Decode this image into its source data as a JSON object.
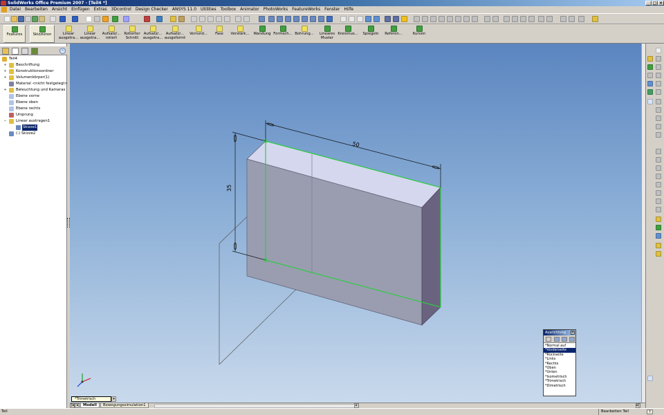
{
  "window": {
    "title": "SolidWorks Office Premium 2007 - [Teil4 *]",
    "controls": {
      "minimize": "_",
      "maximize": "□",
      "close": "×"
    }
  },
  "menu": {
    "items": [
      "Datei",
      "Bearbeiten",
      "Ansicht",
      "Einfügen",
      "Extras",
      "3Dcontrol",
      "Design Checker",
      "ANSYS 11.0",
      "Utilities",
      "Toolbox",
      "Animator",
      "PhotoWorks",
      "FeatureWorks",
      "Fenster",
      "Hilfe"
    ]
  },
  "command_manager": {
    "tabs": [
      {
        "label": "Features"
      },
      {
        "label": "Skizzieren"
      }
    ],
    "buttons": [
      {
        "line1": "Linear",
        "line2": "ausgetra..."
      },
      {
        "line1": "Linear",
        "line2": "ausgetra..."
      },
      {
        "line1": "Aufsatz/...",
        "line2": "rotiert"
      },
      {
        "line1": "Rotierter",
        "line2": "Schnitt"
      },
      {
        "line1": "Aufsatz/...",
        "line2": "ausgetra..."
      },
      {
        "line1": "Aufsatz/...",
        "line2": "ausgeformt"
      },
      {
        "line1": "Verrund...",
        "line2": ""
      },
      {
        "line1": "Fase",
        "line2": ""
      },
      {
        "line1": "Verstärk...",
        "line2": ""
      },
      {
        "line1": "Wandung",
        "line2": ""
      },
      {
        "line1": "Formsch...",
        "line2": ""
      },
      {
        "line1": "Bohrung...",
        "line2": ""
      },
      {
        "line1": "Lineares",
        "line2": "Muster"
      },
      {
        "line1": "Kreismus...",
        "line2": ""
      },
      {
        "line1": "Spiegeln",
        "line2": ""
      },
      {
        "line1": "Referen...",
        "line2": ""
      },
      {
        "line1": "Kurven",
        "line2": ""
      }
    ]
  },
  "feature_tree": {
    "items": [
      {
        "label": "Teil4",
        "icon": "part-icon"
      },
      {
        "label": "Beschriftung",
        "icon": "annotation-icon"
      },
      {
        "label": "Konstruktionsordner",
        "icon": "sensor-icon"
      },
      {
        "label": "Volumenkörper(1)",
        "icon": "solid-bodies-icon"
      },
      {
        "label": "Material <nicht festgelegt>",
        "icon": "material-icon"
      },
      {
        "label": "Beleuchtung und Kameras",
        "icon": "lights-icon"
      },
      {
        "label": "Ebene vorne",
        "icon": "plane-icon"
      },
      {
        "label": "Ebene oben",
        "icon": "plane-icon"
      },
      {
        "label": "Ebene rechts",
        "icon": "plane-icon"
      },
      {
        "label": "Ursprung",
        "icon": "origin-icon"
      },
      {
        "label": "Linear austragen1",
        "icon": "extrude-icon"
      },
      {
        "label": "Skizze1",
        "icon": "sketch-icon"
      },
      {
        "label": "(-) Skizze2",
        "icon": "sketch-icon"
      }
    ]
  },
  "model": {
    "dimension_width": "50",
    "dimension_height": "35"
  },
  "orientation": {
    "title": "Ausrichtung",
    "close": "×",
    "views": [
      "*Normal auf",
      "*Vorderseite",
      "*Rückseite",
      "*Links",
      "*Rechts",
      "*Oben",
      "*Unten",
      "*Isometrisch",
      "*Trimetrisch",
      "*Dimetrisch"
    ],
    "selected": "*Vorderseite"
  },
  "view_dropdown": {
    "value": "*Trimetrisch",
    "arrow": "▾"
  },
  "bottom_tabs": {
    "arrows": [
      "|◂",
      "◂",
      "▸",
      "▸|"
    ],
    "tabs": [
      "Modell",
      "Bewegungssimulation1"
    ]
  },
  "status": {
    "left": "Teil",
    "right": "Bearbeiten Teil",
    "help": "?"
  },
  "colors": {
    "viewport_top": "#5b85c0",
    "viewport_bottom": "#c9d9ec",
    "selection_green": "#2ecc40",
    "face_top": "#d5d7ef",
    "face_front": "#9a9db0",
    "face_side": "#6a6380"
  }
}
